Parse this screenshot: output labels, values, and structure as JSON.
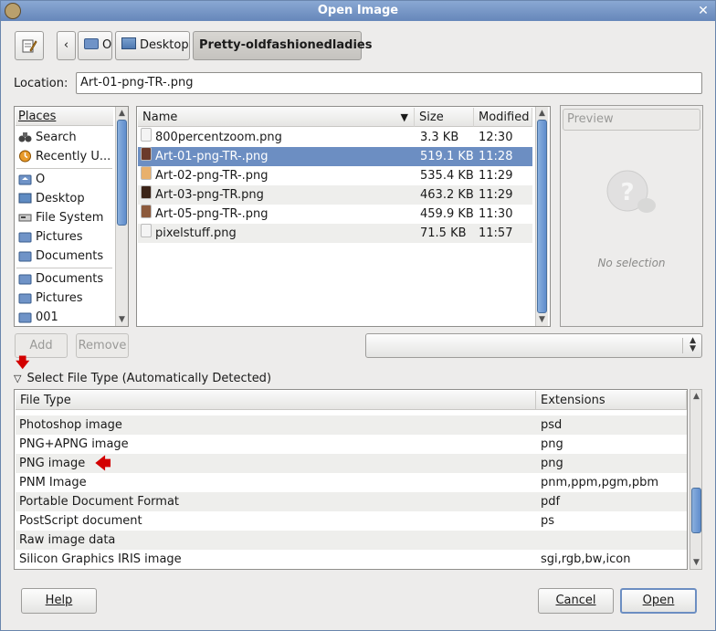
{
  "window": {
    "title": "Open Image"
  },
  "toolbar": {
    "back_glyph": "‹",
    "breadcrumbs": [
      {
        "label": "O"
      },
      {
        "label": "Desktop"
      },
      {
        "label": "Pretty-oldfashionedladies"
      }
    ]
  },
  "location": {
    "label": "Location:",
    "value": "Art-01-png-TR-.png"
  },
  "places": {
    "header": "Places",
    "items": [
      {
        "label": "Search",
        "icon": "binoculars-icon"
      },
      {
        "label": "Recently U...",
        "icon": "clock-icon"
      },
      {
        "label": "O",
        "icon": "home-folder-icon"
      },
      {
        "label": "Desktop",
        "icon": "desktop-icon"
      },
      {
        "label": "File System",
        "icon": "drive-icon"
      },
      {
        "label": "Pictures",
        "icon": "folder-icon"
      },
      {
        "label": "Documents",
        "icon": "folder-icon"
      },
      {
        "label": "Documents",
        "icon": "folder-icon"
      },
      {
        "label": "Pictures",
        "icon": "folder-icon"
      },
      {
        "label": "001",
        "icon": "folder-icon"
      }
    ],
    "add_label": "Add",
    "remove_label": "Remove"
  },
  "files": {
    "columns": {
      "name": "Name",
      "size": "Size",
      "modified": "Modified"
    },
    "rows": [
      {
        "name": "800percentzoom.png",
        "size": "3.3 KB",
        "modified": "12:30",
        "color": "#f4f4f4"
      },
      {
        "name": "Art-01-png-TR-.png",
        "size": "519.1 KB",
        "modified": "11:28",
        "color": "#6b3a2a"
      },
      {
        "name": "Art-02-png-TR-.png",
        "size": "535.4 KB",
        "modified": "11:29",
        "color": "#e8b06c"
      },
      {
        "name": "Art-03-png-TR.png",
        "size": "463.2 KB",
        "modified": "11:29",
        "color": "#3b2418"
      },
      {
        "name": "Art-05-png-TR-.png",
        "size": "459.9 KB",
        "modified": "11:30",
        "color": "#8c5a3c"
      },
      {
        "name": "pixelstuff.png",
        "size": "71.5 KB",
        "modified": "11:57",
        "color": "#f4f4f4"
      }
    ],
    "selected_index": 1
  },
  "preview": {
    "button_label": "Preview",
    "empty_text": "No selection"
  },
  "filetype": {
    "expander_label": "Select File Type (Automatically Detected)",
    "columns": {
      "type": "File Type",
      "ext": "Extensions"
    },
    "rows": [
      {
        "type": "Photoshop image",
        "ext": "psd"
      },
      {
        "type": "PNG+APNG image",
        "ext": "png"
      },
      {
        "type": "PNG image",
        "ext": "png"
      },
      {
        "type": "PNM Image",
        "ext": "pnm,ppm,pgm,pbm"
      },
      {
        "type": "Portable Document Format",
        "ext": "pdf"
      },
      {
        "type": "PostScript document",
        "ext": "ps"
      },
      {
        "type": "Raw image data",
        "ext": ""
      },
      {
        "type": "Silicon Graphics IRIS image",
        "ext": "sgi,rgb,bw,icon"
      }
    ]
  },
  "buttons": {
    "help": "Help",
    "cancel": "Cancel",
    "open": "Open"
  },
  "colors": {
    "selection": "#6c8ec2",
    "title_bar": "#6f90c2",
    "annotation_arrow": "#d30000"
  }
}
